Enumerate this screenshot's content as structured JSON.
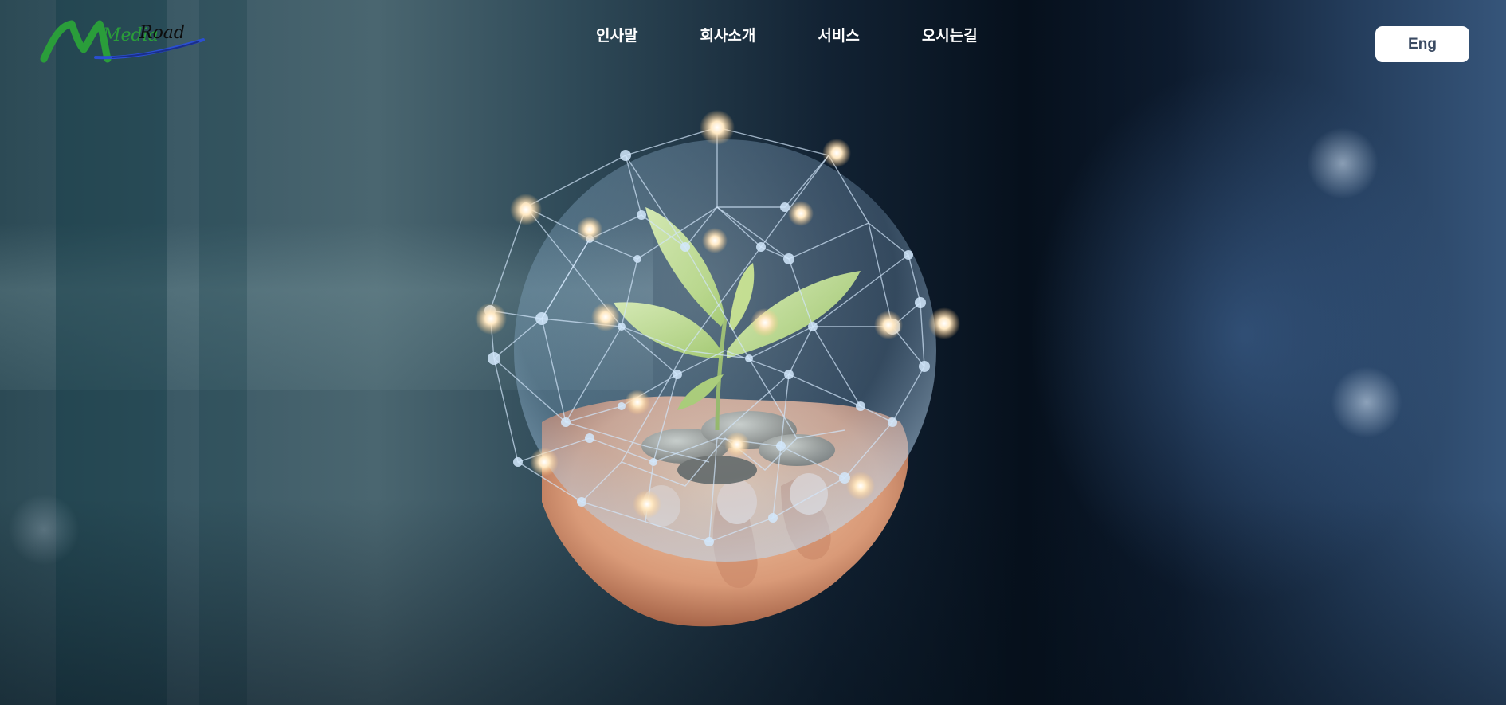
{
  "header": {
    "logo_text_1": "Media",
    "logo_text_2": "Road",
    "nav": [
      {
        "label": "인사말"
      },
      {
        "label": "회사소개"
      },
      {
        "label": "서비스"
      },
      {
        "label": "오시는길"
      }
    ],
    "lang_button": "Eng"
  },
  "hero": {
    "image": "hand-holding-plant-coins-with-network-sphere"
  },
  "colors": {
    "nav_text": "#ffffff",
    "lang_bg": "#ffffff",
    "lang_text": "#3a4a62",
    "logo_green": "#2a9d3a",
    "logo_blue": "#2b4fd1"
  }
}
